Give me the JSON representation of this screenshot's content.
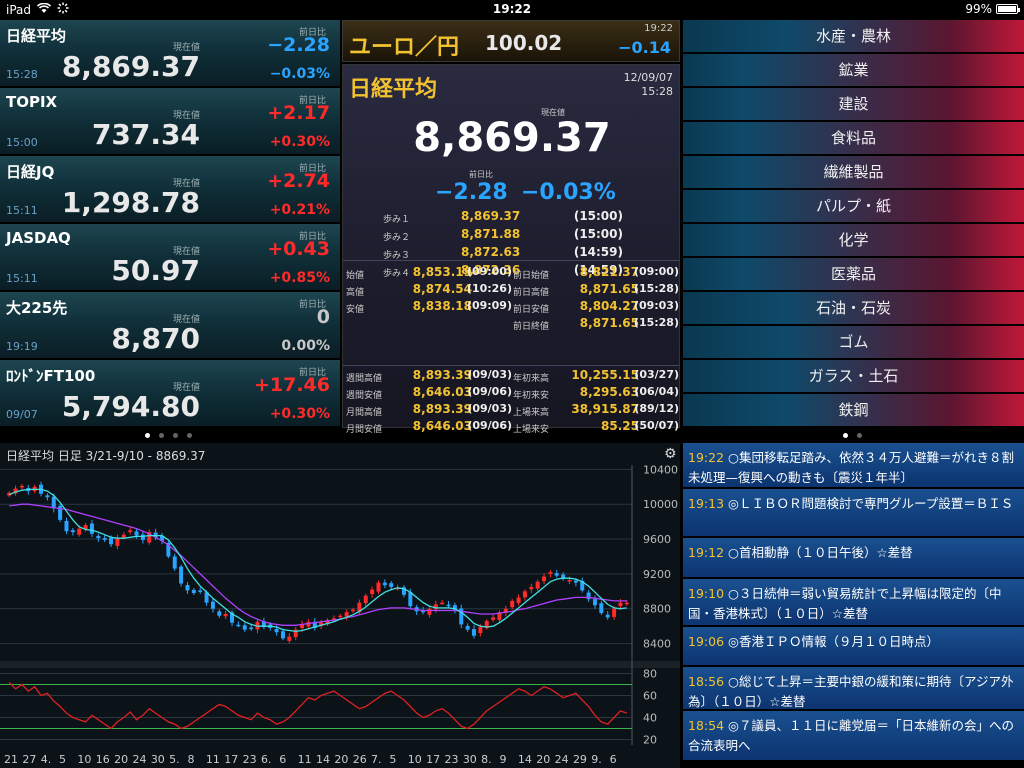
{
  "status_bar": {
    "device": "iPad",
    "time": "19:22",
    "battery": "99%",
    "battery_level": 0.99
  },
  "indices": [
    {
      "name": "日経平均",
      "time": "15:28",
      "price": "8,869.37",
      "change": "−2.28",
      "percent": "−0.03%",
      "dir": "down",
      "prev_label": "前日比",
      "cur_label": "現在値"
    },
    {
      "name": "TOPIX",
      "time": "15:00",
      "price": "737.34",
      "change": "+2.17",
      "percent": "+0.30%",
      "dir": "up",
      "prev_label": "前日比",
      "cur_label": "現在値"
    },
    {
      "name": "日経JQ",
      "time": "15:11",
      "price": "1,298.78",
      "change": "+2.74",
      "percent": "+0.21%",
      "dir": "up",
      "prev_label": "前日比",
      "cur_label": "現在値"
    },
    {
      "name": "JASDAQ",
      "time": "15:11",
      "price": "50.97",
      "change": "+0.43",
      "percent": "+0.85%",
      "dir": "up",
      "prev_label": "前日比",
      "cur_label": "現在値"
    },
    {
      "name": "大225先",
      "time": "19:19",
      "price": "8,870",
      "change": "0",
      "percent": "0.00%",
      "dir": "flat",
      "prev_label": "前日比",
      "cur_label": "現在値"
    },
    {
      "name": "ﾛﾝﾄﾞﾝFT100",
      "time": "09/07",
      "price": "5,794.80",
      "change": "+17.46",
      "percent": "+0.30%",
      "dir": "up",
      "prev_label": "前日比",
      "cur_label": "現在値"
    }
  ],
  "fx": {
    "name": "ユーロ／円",
    "value": "100.02",
    "time": "19:22",
    "change": "−0.14"
  },
  "detail": {
    "title": "日経平均",
    "date": "12/09/07",
    "time": "15:28",
    "cur_label": "現在値",
    "price": "8,869.37",
    "prev_label": "前日比",
    "change": "−2.28",
    "percent": "−0.03%",
    "ayumi": [
      {
        "label": "歩み１",
        "value": "8,869.37",
        "time": "(15:00)"
      },
      {
        "label": "歩み２",
        "value": "8,871.88",
        "time": "(15:00)"
      },
      {
        "label": "歩み３",
        "value": "8,872.63",
        "time": "(14:59)"
      },
      {
        "label": "歩み４",
        "value": "8,872.36",
        "time": "(14:59)"
      }
    ],
    "left_stats": [
      {
        "label": "始値",
        "value": "8,853.19",
        "time": "(09:00)"
      },
      {
        "label": "高値",
        "value": "8,874.54",
        "time": "(10:26)"
      },
      {
        "label": "安値",
        "value": "8,838.18",
        "time": "(09:09)"
      }
    ],
    "right_stats": [
      {
        "label": "前日始値",
        "value": "8,821.37",
        "time": "(09:00)"
      },
      {
        "label": "前日高値",
        "value": "8,871.65",
        "time": "(15:28)"
      },
      {
        "label": "前日安値",
        "value": "8,804.27",
        "time": "(09:03)"
      },
      {
        "label": "前日終値",
        "value": "8,871.65",
        "time": "(15:28)"
      }
    ],
    "left_stats2": [
      {
        "label": "週間高値",
        "value": "8,893.39",
        "time": "(09/03)"
      },
      {
        "label": "週間安値",
        "value": "8,646.03",
        "time": "(09/06)"
      },
      {
        "label": "月間高値",
        "value": "8,893.39",
        "time": "(09/03)"
      },
      {
        "label": "月間安値",
        "value": "8,646.03",
        "time": "(09/06)"
      }
    ],
    "right_stats2": [
      {
        "label": "年初来高",
        "value": "10,255.15",
        "time": "(03/27)"
      },
      {
        "label": "年初来安",
        "value": "8,295.63",
        "time": "(06/04)"
      },
      {
        "label": "上場来高",
        "value": "38,915.87",
        "time": "(89/12)"
      },
      {
        "label": "上場来安",
        "value": "85.25",
        "time": "(50/07)"
      }
    ]
  },
  "sectors": [
    "水産・農林",
    "鉱業",
    "建設",
    "食料品",
    "繊維製品",
    "パルプ・紙",
    "化学",
    "医薬品",
    "石油・石炭",
    "ゴム",
    "ガラス・土石",
    "鉄鋼"
  ],
  "colors": {
    "up": "#ff2a2a",
    "down": "#2aa4ff",
    "gold": "#f2c230",
    "ma_short": "#40e0e0",
    "ma_long": "#b040ff",
    "oscillator": "#e02020"
  },
  "chart": {
    "title": "日経平均 日足 3/21-9/10 - 8869.37",
    "gear": "gear-icon"
  },
  "chart_data": {
    "type": "candlestick",
    "title": "日経平均 日足 3/21-9/10 - 8869.37",
    "y_ticks": [
      "10400",
      "10000",
      "9600",
      "9200",
      "8800",
      "8400"
    ],
    "ylim": [
      8200,
      10450
    ],
    "osc_ticks": [
      "80",
      "60",
      "40",
      "20"
    ],
    "osc_lim": [
      15,
      85
    ],
    "osc_lines": [
      70,
      30
    ],
    "x_ticks": [
      "21",
      "27",
      "4.",
      "5",
      "10",
      "16",
      "20",
      "24",
      "30",
      "5.",
      "8",
      "11",
      "17",
      "23",
      "6.",
      "6",
      "11",
      "14",
      "20",
      "26",
      "7.",
      "5",
      "10",
      "17",
      "23",
      "30",
      "8.",
      "9",
      "14",
      "20",
      "24",
      "29",
      "9.",
      "6"
    ],
    "close": [
      10130,
      10180,
      10210,
      10150,
      10200,
      10120,
      10080,
      9950,
      9820,
      9690,
      9680,
      9720,
      9760,
      9660,
      9610,
      9590,
      9540,
      9610,
      9650,
      9700,
      9640,
      9590,
      9680,
      9620,
      9580,
      9400,
      9260,
      9090,
      9010,
      8980,
      9000,
      8870,
      8800,
      8720,
      8740,
      8640,
      8610,
      8560,
      8580,
      8650,
      8590,
      8580,
      8530,
      8460,
      8480,
      8560,
      8620,
      8650,
      8580,
      8640,
      8670,
      8690,
      8720,
      8760,
      8790,
      8870,
      8950,
      9020,
      9100,
      9070,
      9050,
      9040,
      8960,
      8830,
      8770,
      8760,
      8800,
      8850,
      8870,
      8840,
      8780,
      8620,
      8560,
      8490,
      8590,
      8660,
      8700,
      8760,
      8800,
      8890,
      8930,
      9000,
      9050,
      9110,
      9170,
      9220,
      9180,
      9150,
      9130,
      9100,
      9010,
      8910,
      8840,
      8750,
      8700,
      8800,
      8870,
      8869
    ],
    "ma_short": [
      10110,
      10140,
      10160,
      10170,
      10170,
      10170,
      10150,
      10100,
      10020,
      9920,
      9820,
      9740,
      9710,
      9700,
      9680,
      9650,
      9620,
      9610,
      9610,
      9620,
      9630,
      9630,
      9640,
      9640,
      9640,
      9590,
      9500,
      9390,
      9260,
      9150,
      9060,
      8990,
      8920,
      8860,
      8800,
      8740,
      8700,
      8650,
      8620,
      8600,
      8600,
      8600,
      8590,
      8560,
      8550,
      8540,
      8550,
      8570,
      8590,
      8610,
      8630,
      8650,
      8680,
      8700,
      8730,
      8770,
      8820,
      8880,
      8940,
      8990,
      9020,
      9040,
      9030,
      8990,
      8930,
      8870,
      8830,
      8810,
      8810,
      8810,
      8800,
      8760,
      8700,
      8630,
      8600,
      8590,
      8600,
      8640,
      8690,
      8750,
      8810,
      8870,
      8930,
      8990,
      9050,
      9110,
      9140,
      9150,
      9150,
      9140,
      9110,
      9060,
      8990,
      8920,
      8850,
      8810,
      8800,
      8810
    ],
    "ma_long": [
      9980,
      9990,
      10000,
      10000,
      9990,
      9980,
      9970,
      9960,
      9950,
      9940,
      9920,
      9900,
      9880,
      9860,
      9840,
      9820,
      9800,
      9780,
      9760,
      9740,
      9720,
      9690,
      9660,
      9620,
      9580,
      9530,
      9470,
      9410,
      9340,
      9270,
      9200,
      9130,
      9060,
      8990,
      8920,
      8860,
      8800,
      8750,
      8710,
      8680,
      8650,
      8630,
      8620,
      8610,
      8610,
      8610,
      8620,
      8630,
      8640,
      8650,
      8660,
      8670,
      8680,
      8700,
      8710,
      8730,
      8750,
      8770,
      8790,
      8800,
      8810,
      8810,
      8810,
      8800,
      8790,
      8780,
      8780,
      8780,
      8780,
      8780,
      8780,
      8770,
      8760,
      8750,
      8740,
      8740,
      8740,
      8750,
      8760,
      8770,
      8790,
      8800,
      8820,
      8840,
      8860,
      8880,
      8900,
      8910,
      8920,
      8930,
      8930,
      8930,
      8920,
      8910,
      8900,
      8890,
      8890,
      8890
    ],
    "oscillator": [
      72,
      66,
      70,
      64,
      68,
      60,
      62,
      55,
      50,
      44,
      40,
      38,
      36,
      42,
      38,
      34,
      30,
      36,
      40,
      45,
      38,
      42,
      48,
      44,
      40,
      36,
      34,
      30,
      32,
      36,
      40,
      44,
      48,
      52,
      50,
      46,
      42,
      40,
      38,
      44,
      40,
      38,
      34,
      36,
      40,
      46,
      52,
      58,
      56,
      60,
      62,
      64,
      60,
      56,
      52,
      48,
      50,
      54,
      58,
      62,
      64,
      60,
      56,
      50,
      44,
      40,
      42,
      46,
      48,
      44,
      38,
      32,
      30,
      34,
      40,
      46,
      50,
      54,
      58,
      62,
      66,
      64,
      60,
      64,
      68,
      66,
      62,
      58,
      60,
      62,
      56,
      50,
      42,
      36,
      34,
      40,
      46,
      44
    ]
  },
  "news": [
    {
      "time": "19:22",
      "text": "○集団移転足踏み、依然３４万人避難＝がれき８割未処理—復興への動きも〔震災１年半〕"
    },
    {
      "time": "19:13",
      "text": "◎ＬＩＢＯＲ問題検討で専門グループ設置＝ＢＩＳ"
    },
    {
      "time": "19:12",
      "text": "○首相動静（１０日午後）☆差替"
    },
    {
      "time": "19:10",
      "text": "○３日続伸＝弱い貿易統計で上昇幅は限定的〔中国・香港株式〕（１０日）☆差替"
    },
    {
      "time": "19:06",
      "text": "◎香港ＩＰＯ情報（９月１０日時点）"
    },
    {
      "time": "18:56",
      "text": "○総じて上昇＝主要中銀の緩和策に期待〔アジア外為〕（１０日）☆差替"
    },
    {
      "time": "18:54",
      "text": "◎７議員、１１日に離党届＝「日本維新の会」への合流表明へ"
    }
  ]
}
